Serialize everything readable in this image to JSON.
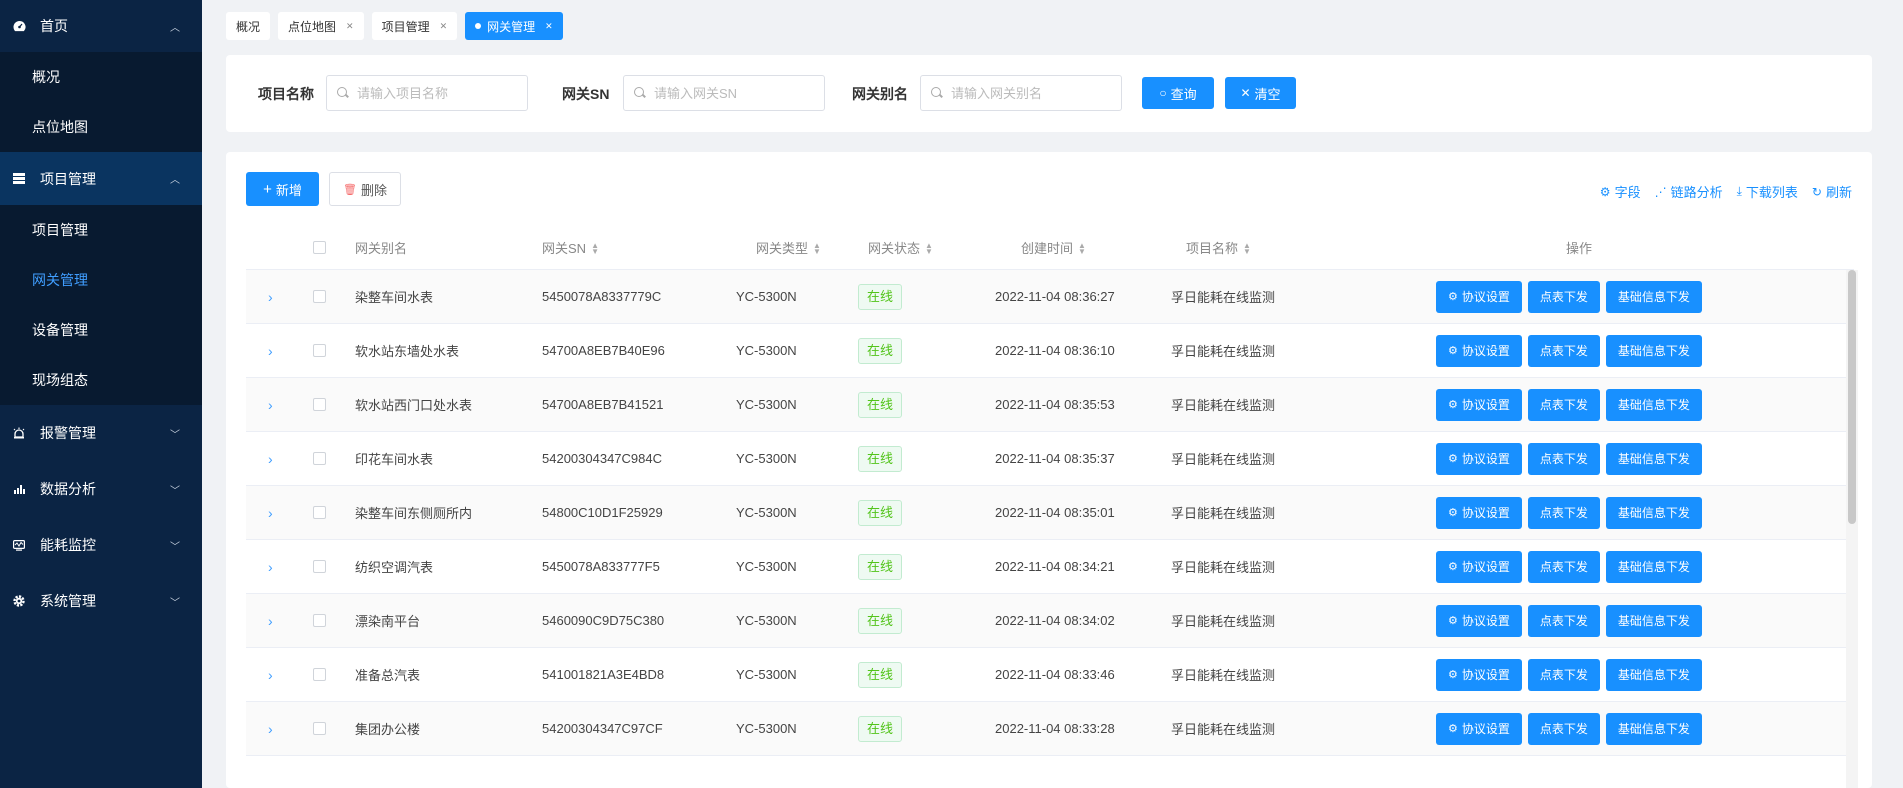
{
  "sidebar": {
    "groups": [
      {
        "label": "首页",
        "icon": "dashboard-icon",
        "open": true,
        "items": [
          "概况",
          "点位地图"
        ]
      },
      {
        "label": "项目管理",
        "icon": "project-icon",
        "open": true,
        "items": [
          "项目管理",
          "网关管理",
          "设备管理",
          "现场组态"
        ]
      },
      {
        "label": "报警管理",
        "icon": "alarm-icon",
        "open": false,
        "items": []
      },
      {
        "label": "数据分析",
        "icon": "bar-chart-icon",
        "open": false,
        "items": []
      },
      {
        "label": "能耗监控",
        "icon": "monitor-icon",
        "open": false,
        "items": []
      },
      {
        "label": "系统管理",
        "icon": "gear-icon",
        "open": false,
        "items": []
      }
    ],
    "selected": "网关管理"
  },
  "tabs": [
    {
      "label": "概况",
      "closable": false
    },
    {
      "label": "点位地图",
      "closable": true
    },
    {
      "label": "项目管理",
      "closable": true
    },
    {
      "label": "网关管理",
      "closable": true,
      "active": true
    }
  ],
  "search": {
    "project_label": "项目名称",
    "project_placeholder": "请输入项目名称",
    "sn_label": "网关SN",
    "sn_placeholder": "请输入网关SN",
    "alias_label": "网关别名",
    "alias_placeholder": "请输入网关别名",
    "query_label": "查询",
    "clear_label": "清空"
  },
  "toolbar": {
    "add_label": "新增",
    "delete_label": "删除",
    "fields_label": "字段",
    "link_analysis_label": "链路分析",
    "download_label": "下载列表",
    "refresh_label": "刷新"
  },
  "table": {
    "columns": {
      "alias": "网关别名",
      "sn": "网关SN",
      "type": "网关类型",
      "status": "网关状态",
      "time": "创建时间",
      "project": "项目名称",
      "ops": "操作"
    },
    "op_labels": {
      "protocol": "协议设置",
      "meter": "点表下发",
      "basic": "基础信息下发"
    },
    "rows": [
      {
        "alias": "染整车间水表",
        "sn": "5450078A8337779C",
        "type": "YC-5300N",
        "status": "在线",
        "time": "2022-11-04 08:36:27",
        "project": "孚日能耗在线监测"
      },
      {
        "alias": "软水站东墙处水表",
        "sn": "54700A8EB7B40E96",
        "type": "YC-5300N",
        "status": "在线",
        "time": "2022-11-04 08:36:10",
        "project": "孚日能耗在线监测"
      },
      {
        "alias": "软水站西门口处水表",
        "sn": "54700A8EB7B41521",
        "type": "YC-5300N",
        "status": "在线",
        "time": "2022-11-04 08:35:53",
        "project": "孚日能耗在线监测"
      },
      {
        "alias": "印花车间水表",
        "sn": "54200304347C984C",
        "type": "YC-5300N",
        "status": "在线",
        "time": "2022-11-04 08:35:37",
        "project": "孚日能耗在线监测"
      },
      {
        "alias": "染整车间东侧厕所内",
        "sn": "54800C10D1F25929",
        "type": "YC-5300N",
        "status": "在线",
        "time": "2022-11-04 08:35:01",
        "project": "孚日能耗在线监测"
      },
      {
        "alias": "纺织空调汽表",
        "sn": "5450078A833777F5",
        "type": "YC-5300N",
        "status": "在线",
        "time": "2022-11-04 08:34:21",
        "project": "孚日能耗在线监测"
      },
      {
        "alias": "漂染南平台",
        "sn": "5460090C9D75C380",
        "type": "YC-5300N",
        "status": "在线",
        "time": "2022-11-04 08:34:02",
        "project": "孚日能耗在线监测"
      },
      {
        "alias": "准备总汽表",
        "sn": "541001821A3E4BD8",
        "type": "YC-5300N",
        "status": "在线",
        "time": "2022-11-04 08:33:46",
        "project": "孚日能耗在线监测"
      },
      {
        "alias": "集团办公楼",
        "sn": "54200304347C97CF",
        "type": "YC-5300N",
        "status": "在线",
        "time": "2022-11-04 08:33:28",
        "project": "孚日能耗在线监测"
      }
    ]
  }
}
